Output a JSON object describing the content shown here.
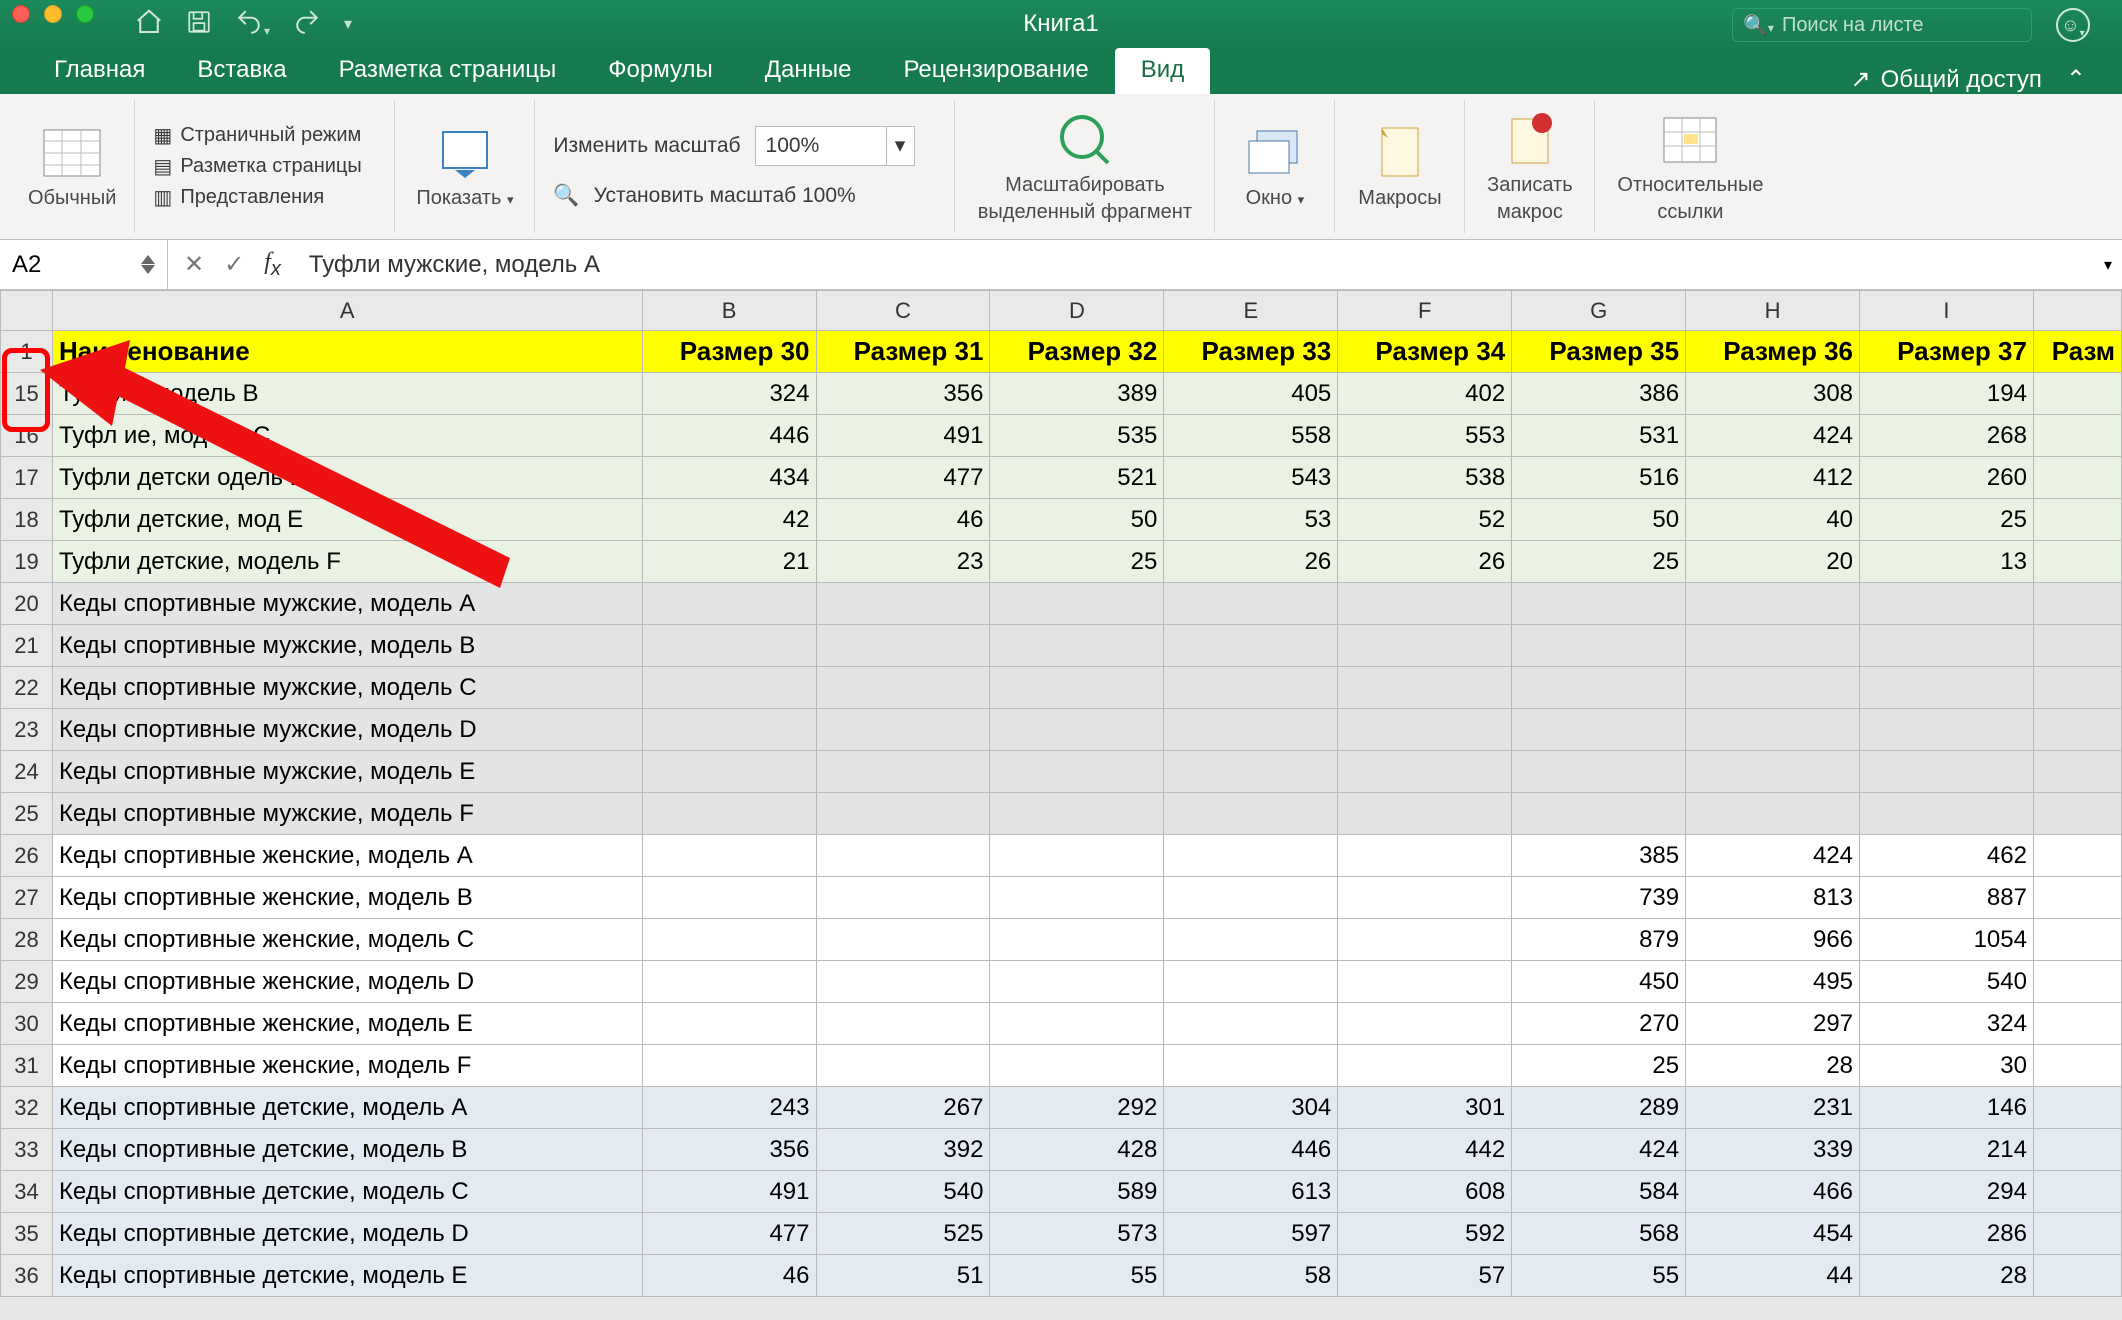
{
  "title": "Книга1",
  "search_placeholder": "Поиск на листе",
  "tabs": [
    "Главная",
    "Вставка",
    "Разметка страницы",
    "Формулы",
    "Данные",
    "Рецензирование",
    "Вид"
  ],
  "active_tab": "Вид",
  "share": "Общий доступ",
  "ribbon": {
    "normal": "Обычный",
    "pagebreak": "Страничный режим",
    "layout": "Разметка страницы",
    "views": "Представления",
    "show": "Показать",
    "zoom_label": "Изменить масштаб",
    "zoom_value": "100%",
    "zoom100": "Установить масштаб 100%",
    "zoom_sel": "Масштабировать",
    "zoom_sel2": "выделенный фрагмент",
    "window": "Окно",
    "macros": "Макросы",
    "record": "Записать",
    "record2": "макрос",
    "relref": "Относительные",
    "relref2": "ссылки"
  },
  "namebox": "A2",
  "formula": "Туфли мужские, модель A",
  "cols": [
    "A",
    "B",
    "C",
    "D",
    "E",
    "F",
    "G",
    "H",
    "I",
    ""
  ],
  "header_row": [
    "Наименование",
    "Размер 30",
    "Размер 31",
    "Размер 32",
    "Размер 33",
    "Размер 34",
    "Размер 35",
    "Размер 36",
    "Размер 37",
    "Разм"
  ],
  "rows": [
    {
      "n": 1,
      "style": "hrow",
      "cells": [
        "Наименование",
        "Размер 30",
        "Размер 31",
        "Размер 32",
        "Размер 33",
        "Размер 34",
        "Размер 35",
        "Размер 36",
        "Размер 37",
        "Разм"
      ]
    },
    {
      "n": 15,
      "style": "greenish",
      "cells": [
        "Ту                     ские, модель B",
        "324",
        "356",
        "389",
        "405",
        "402",
        "386",
        "308",
        "194",
        ""
      ]
    },
    {
      "n": 16,
      "style": "greenish",
      "cells": [
        "Туфл                    ие, модель C",
        "446",
        "491",
        "535",
        "558",
        "553",
        "531",
        "424",
        "268",
        ""
      ]
    },
    {
      "n": 17,
      "style": "greenish",
      "cells": [
        "Туфли детски             одель D",
        "434",
        "477",
        "521",
        "543",
        "538",
        "516",
        "412",
        "260",
        ""
      ]
    },
    {
      "n": 18,
      "style": "greenish",
      "cells": [
        "Туфли детские, мод           E",
        "42",
        "46",
        "50",
        "53",
        "52",
        "50",
        "40",
        "25",
        ""
      ]
    },
    {
      "n": 19,
      "style": "greenish",
      "cells": [
        "Туфли детские, модель F",
        "21",
        "23",
        "25",
        "26",
        "26",
        "25",
        "20",
        "13",
        ""
      ]
    },
    {
      "n": 20,
      "style": "greyish",
      "cells": [
        "Кеды спортивные мужские, модель A",
        "",
        "",
        "",
        "",
        "",
        "",
        "",
        "",
        ""
      ]
    },
    {
      "n": 21,
      "style": "greyish",
      "cells": [
        "Кеды спортивные мужские, модель B",
        "",
        "",
        "",
        "",
        "",
        "",
        "",
        "",
        ""
      ]
    },
    {
      "n": 22,
      "style": "greyish",
      "cells": [
        "Кеды спортивные мужские, модель C",
        "",
        "",
        "",
        "",
        "",
        "",
        "",
        "",
        ""
      ]
    },
    {
      "n": 23,
      "style": "greyish",
      "cells": [
        "Кеды спортивные мужские, модель D",
        "",
        "",
        "",
        "",
        "",
        "",
        "",
        "",
        ""
      ]
    },
    {
      "n": 24,
      "style": "greyish",
      "cells": [
        "Кеды спортивные мужские, модель E",
        "",
        "",
        "",
        "",
        "",
        "",
        "",
        "",
        ""
      ]
    },
    {
      "n": 25,
      "style": "greyish",
      "cells": [
        "Кеды спортивные мужские, модель F",
        "",
        "",
        "",
        "",
        "",
        "",
        "",
        "",
        ""
      ]
    },
    {
      "n": 26,
      "style": "whitish",
      "cells": [
        "Кеды спортивные женские, модель A",
        "",
        "",
        "",
        "",
        "",
        "385",
        "424",
        "462",
        ""
      ]
    },
    {
      "n": 27,
      "style": "whitish",
      "cells": [
        "Кеды спортивные женские, модель B",
        "",
        "",
        "",
        "",
        "",
        "739",
        "813",
        "887",
        ""
      ]
    },
    {
      "n": 28,
      "style": "whitish",
      "cells": [
        "Кеды спортивные женские, модель C",
        "",
        "",
        "",
        "",
        "",
        "879",
        "966",
        "1054",
        ""
      ]
    },
    {
      "n": 29,
      "style": "whitish",
      "cells": [
        "Кеды спортивные женские, модель D",
        "",
        "",
        "",
        "",
        "",
        "450",
        "495",
        "540",
        ""
      ]
    },
    {
      "n": 30,
      "style": "whitish",
      "cells": [
        "Кеды спортивные женские, модель E",
        "",
        "",
        "",
        "",
        "",
        "270",
        "297",
        "324",
        ""
      ]
    },
    {
      "n": 31,
      "style": "whitish",
      "cells": [
        "Кеды спортивные женские, модель F",
        "",
        "",
        "",
        "",
        "",
        "25",
        "28",
        "30",
        ""
      ]
    },
    {
      "n": 32,
      "style": "bluish",
      "cells": [
        "Кеды спортивные детские, модель A",
        "243",
        "267",
        "292",
        "304",
        "301",
        "289",
        "231",
        "146",
        ""
      ]
    },
    {
      "n": 33,
      "style": "bluish",
      "cells": [
        "Кеды спортивные детские, модель B",
        "356",
        "392",
        "428",
        "446",
        "442",
        "424",
        "339",
        "214",
        ""
      ]
    },
    {
      "n": 34,
      "style": "bluish",
      "cells": [
        "Кеды спортивные детские, модель C",
        "491",
        "540",
        "589",
        "613",
        "608",
        "584",
        "466",
        "294",
        ""
      ]
    },
    {
      "n": 35,
      "style": "bluish",
      "cells": [
        "Кеды спортивные детские, модель D",
        "477",
        "525",
        "573",
        "597",
        "592",
        "568",
        "454",
        "286",
        ""
      ]
    },
    {
      "n": 36,
      "style": "bluish",
      "cells": [
        "Кеды спортивные детские, модель E",
        "46",
        "51",
        "55",
        "58",
        "57",
        "55",
        "44",
        "28",
        ""
      ]
    }
  ]
}
